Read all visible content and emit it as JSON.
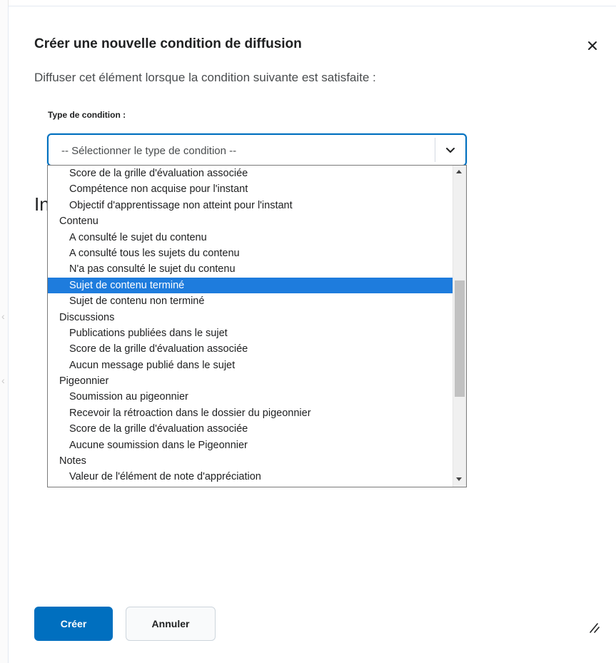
{
  "dialog": {
    "title": "Créer une nouvelle condition de diffusion",
    "subtitle": "Diffuser cet élément lorsque la condition suivante est satisfaite :",
    "close_icon": "close-icon",
    "background_heading_fragment": "In"
  },
  "condition_type": {
    "label": "Type de condition :",
    "selected_value": "-- Sélectionner le type de condition --",
    "chevron_icon": "chevron-down-icon"
  },
  "dropdown_options": [
    {
      "label": "Score de la grille d'évaluation associée",
      "kind": "option",
      "selected": false
    },
    {
      "label": "Compétence non acquise pour l'instant",
      "kind": "option",
      "selected": false
    },
    {
      "label": "Objectif d'apprentissage non atteint pour l'instant",
      "kind": "option",
      "selected": false
    },
    {
      "label": "Contenu",
      "kind": "group",
      "selected": false
    },
    {
      "label": "A consulté le sujet du contenu",
      "kind": "option",
      "selected": false
    },
    {
      "label": "A consulté tous les sujets du contenu",
      "kind": "option",
      "selected": false
    },
    {
      "label": "N'a pas consulté le sujet du contenu",
      "kind": "option",
      "selected": false
    },
    {
      "label": "Sujet de contenu terminé",
      "kind": "option",
      "selected": true
    },
    {
      "label": "Sujet de contenu non terminé",
      "kind": "option",
      "selected": false
    },
    {
      "label": "Discussions",
      "kind": "group",
      "selected": false
    },
    {
      "label": "Publications publiées dans le sujet",
      "kind": "option",
      "selected": false
    },
    {
      "label": "Score de la grille d'évaluation associée",
      "kind": "option",
      "selected": false
    },
    {
      "label": "Aucun message publié dans le sujet",
      "kind": "option",
      "selected": false
    },
    {
      "label": "Pigeonnier",
      "kind": "group",
      "selected": false
    },
    {
      "label": "Soumission au pigeonnier",
      "kind": "option",
      "selected": false
    },
    {
      "label": "Recevoir la rétroaction dans le dossier du pigeonnier",
      "kind": "option",
      "selected": false
    },
    {
      "label": "Score de la grille d'évaluation associée",
      "kind": "option",
      "selected": false
    },
    {
      "label": "Aucune soumission dans le Pigeonnier",
      "kind": "option",
      "selected": false
    },
    {
      "label": "Notes",
      "kind": "group",
      "selected": false
    },
    {
      "label": "Valeur de l'élément de note d'appréciation",
      "kind": "option",
      "selected": false
    }
  ],
  "footer": {
    "create_label": "Créer",
    "cancel_label": "Annuler",
    "resize_icon": "resize-grip-icon"
  },
  "colors": {
    "primary": "#006fbf",
    "selected_option": "#1e7cdd"
  }
}
